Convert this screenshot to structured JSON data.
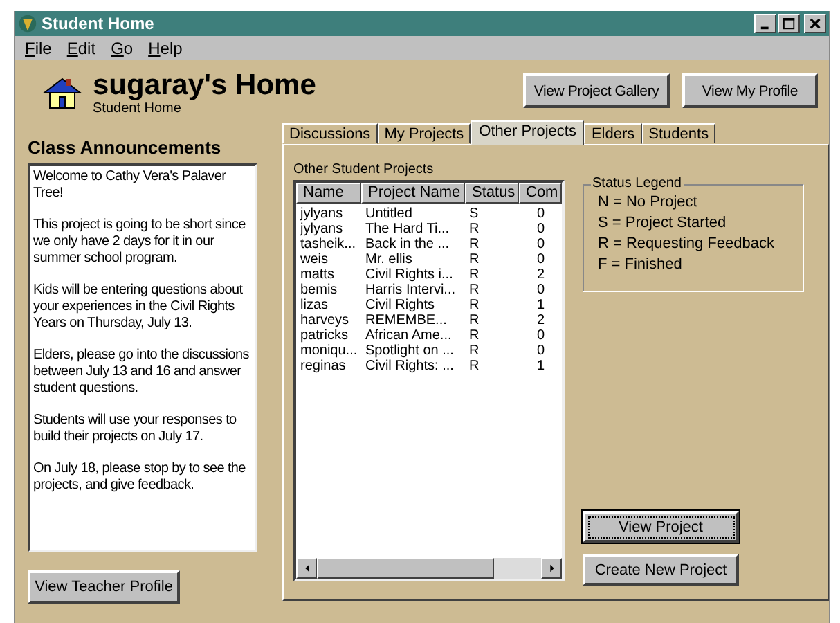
{
  "window": {
    "title": "Student Home"
  },
  "menu": [
    "File",
    "Edit",
    "Go",
    "Help"
  ],
  "header": {
    "title": "sugaray's Home",
    "subtitle": "Student Home",
    "buttons": [
      "View Project Gallery",
      "View My Profile"
    ]
  },
  "announcements": {
    "title": "Class Announcements",
    "paragraphs": [
      "Welcome to Cathy Vera's Palaver Tree!",
      "This project is going to be short since we only have 2 days for it in our summer school program.",
      "Kids will be entering questions about your experiences in the Civil Rights Years on Thursday, July 13.",
      "Elders, please go into the discussions between July 13 and 16 and answer student questions.",
      "Students will use your responses to build their projects on July 17.",
      "On July 18, please stop by to see the projects, and give feedback."
    ],
    "button": "View Teacher Profile"
  },
  "tabs": [
    {
      "label": "Discussions",
      "selected": false
    },
    {
      "label": "My Projects",
      "selected": false
    },
    {
      "label": "Other Projects",
      "selected": true
    },
    {
      "label": "Elders",
      "selected": false
    },
    {
      "label": "Students",
      "selected": false
    }
  ],
  "projects": {
    "label": "Other Student Projects",
    "columns": [
      "Name",
      "Project Name",
      "Status",
      "Com"
    ],
    "rows": [
      [
        "jylyans",
        "Untitled",
        "S",
        "0"
      ],
      [
        "jylyans",
        "The Hard Ti...",
        "R",
        "0"
      ],
      [
        "tasheik...",
        "Back in the ...",
        "R",
        "0"
      ],
      [
        "weis",
        "Mr. ellis",
        "R",
        "0"
      ],
      [
        "matts",
        "Civil Rights i...",
        "R",
        "2"
      ],
      [
        "bemis",
        "Harris Intervi...",
        "R",
        "0"
      ],
      [
        "lizas",
        "Civil Rights",
        "R",
        "1"
      ],
      [
        "harveys",
        "REMEMBE...",
        "R",
        "2"
      ],
      [
        "patricks",
        "African Ame...",
        "R",
        "0"
      ],
      [
        "moniqu...",
        "Spotlight on ...",
        "R",
        "0"
      ],
      [
        "reginas",
        "Civil Rights: ...",
        "R",
        "1"
      ]
    ]
  },
  "legend": {
    "title": "Status Legend",
    "items": [
      "N = No Project",
      "S = Project Started",
      "R = Requesting Feedback",
      "F = Finished"
    ]
  },
  "actions": [
    {
      "label": "View Project",
      "focused": true
    },
    {
      "label": "Create New Project",
      "focused": false
    }
  ]
}
